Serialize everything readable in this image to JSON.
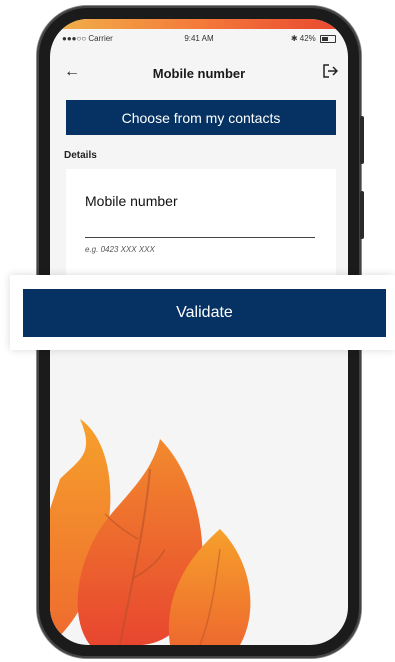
{
  "status_bar": {
    "carrier": "●●●○○ Carrier",
    "time": "9:41 AM",
    "battery": "42%"
  },
  "navbar": {
    "title": "Mobile number",
    "back_icon": "arrow-left-icon",
    "logout_icon": "logout-icon"
  },
  "contacts_button": {
    "label": "Choose from my contacts"
  },
  "details": {
    "label": "Details"
  },
  "mobile_field": {
    "label": "Mobile number",
    "hint": "e.g. 0423 XXX XXX",
    "value": ""
  },
  "validate_button": {
    "label": "Validate"
  },
  "colors": {
    "primary": "#053262",
    "background": "#f5f5f5",
    "flame_orange": "#f6a02c",
    "flame_red": "#e8462f"
  }
}
